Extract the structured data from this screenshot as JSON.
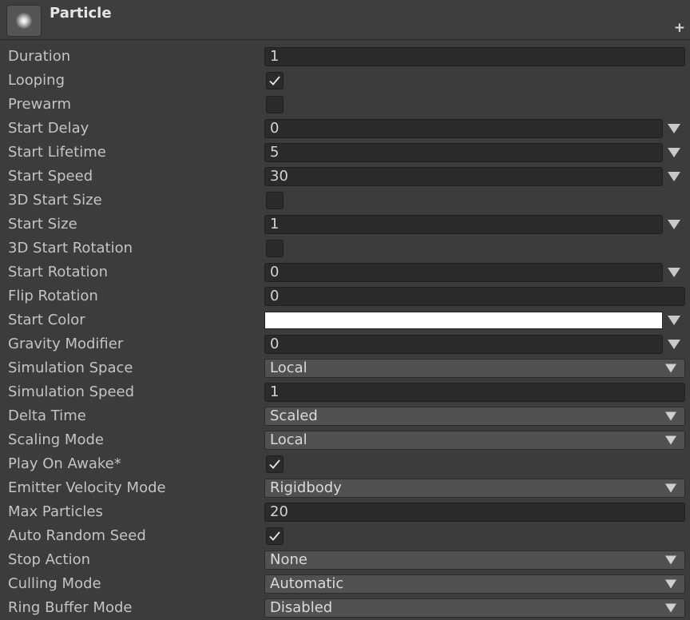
{
  "header": {
    "title": "Particle",
    "add_glyph": "+",
    "icon": "particle-icon",
    "add_icon": "plus-icon"
  },
  "colors": {
    "background": "#3c3c3c",
    "field_bg": "#2a2a2a",
    "dropdown_bg": "#515151",
    "start_color_swatch": "#ffffff",
    "label_text": "#c4c4c4"
  },
  "properties": [
    {
      "label": "Duration",
      "kind": "text",
      "value": "1"
    },
    {
      "label": "Looping",
      "kind": "checkbox",
      "checked": true
    },
    {
      "label": "Prewarm",
      "kind": "checkbox",
      "checked": false
    },
    {
      "label": "Start Delay",
      "kind": "text-curve",
      "value": "0"
    },
    {
      "label": "Start Lifetime",
      "kind": "text-curve",
      "value": "5"
    },
    {
      "label": "Start Speed",
      "kind": "text-curve",
      "value": "30"
    },
    {
      "label": "3D Start Size",
      "kind": "checkbox",
      "checked": false
    },
    {
      "label": "Start Size",
      "kind": "text-curve",
      "value": "1"
    },
    {
      "label": "3D Start Rotation",
      "kind": "checkbox",
      "checked": false
    },
    {
      "label": "Start Rotation",
      "kind": "text-curve",
      "value": "0"
    },
    {
      "label": "Flip Rotation",
      "kind": "text",
      "value": "0"
    },
    {
      "label": "Start Color",
      "kind": "color",
      "value": "#ffffff"
    },
    {
      "label": "Gravity Modifier",
      "kind": "text-curve",
      "value": "0"
    },
    {
      "label": "Simulation Space",
      "kind": "dropdown",
      "value": "Local"
    },
    {
      "label": "Simulation Speed",
      "kind": "text",
      "value": "1"
    },
    {
      "label": "Delta Time",
      "kind": "dropdown",
      "value": "Scaled"
    },
    {
      "label": "Scaling Mode",
      "kind": "dropdown",
      "value": "Local"
    },
    {
      "label": "Play On Awake*",
      "kind": "checkbox",
      "checked": true
    },
    {
      "label": "Emitter Velocity Mode",
      "kind": "dropdown",
      "value": "Rigidbody"
    },
    {
      "label": "Max Particles",
      "kind": "text",
      "value": "20"
    },
    {
      "label": "Auto Random Seed",
      "kind": "checkbox",
      "checked": true
    },
    {
      "label": "Stop Action",
      "kind": "dropdown",
      "value": "None"
    },
    {
      "label": "Culling Mode",
      "kind": "dropdown",
      "value": "Automatic"
    },
    {
      "label": "Ring Buffer Mode",
      "kind": "dropdown",
      "value": "Disabled"
    }
  ]
}
